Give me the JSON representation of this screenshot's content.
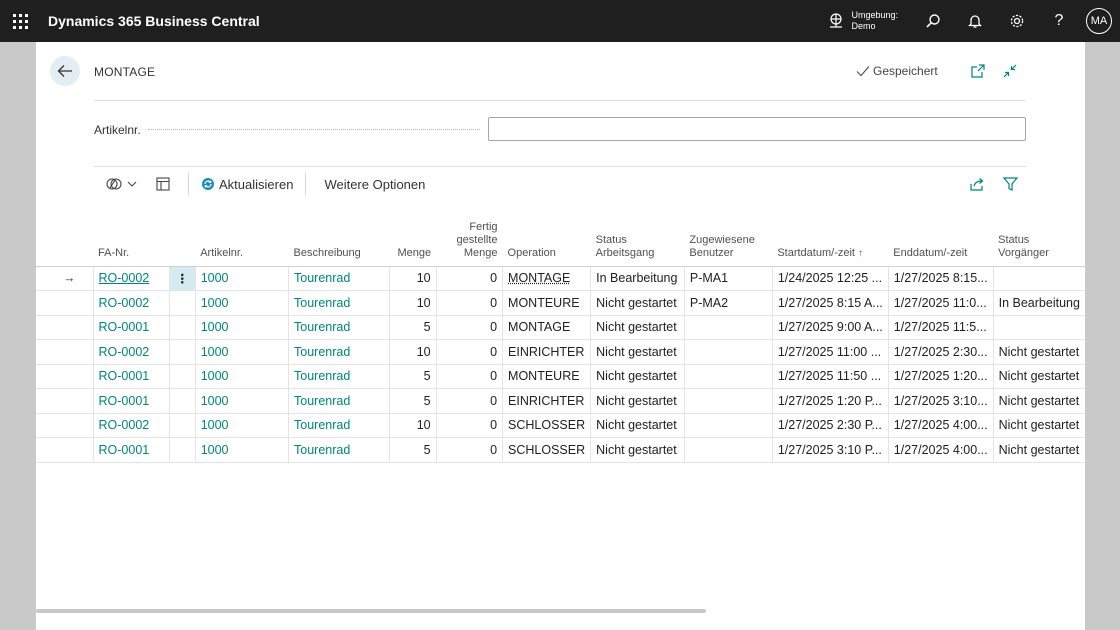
{
  "app": {
    "title": "Dynamics 365 Business Central",
    "environment_label": "Umgebung:",
    "environment_value": "Demo",
    "user_initials": "MA"
  },
  "page": {
    "title": "MONTAGE",
    "saved_status": "Gespeichert"
  },
  "filter": {
    "label": "Artikelnr.",
    "value": ""
  },
  "toolbar": {
    "refresh_label": "Aktualisieren",
    "more_options_label": "Weitere Optionen"
  },
  "table": {
    "headers": {
      "fa_nr": "FA-Nr.",
      "artikelnr": "Artikelnr.",
      "beschreibung": "Beschreibung",
      "menge": "Menge",
      "fertig_line1": "Fertig",
      "fertig_line2": "gestellte",
      "fertig_line3": "Menge",
      "operation": "Operation",
      "status_ag_line1": "Status",
      "status_ag_line2": "Arbeitsgang",
      "zugewiesen_line1": "Zugewiesene",
      "zugewiesen_line2": "Benutzer",
      "startdatum": "Startdatum/-zeit",
      "enddatum": "Enddatum/-zeit",
      "status_vorgaenger": "Status Vorgänger"
    },
    "rows": [
      {
        "fa_nr": "RO-0002",
        "artikelnr": "1000",
        "beschreibung": "Tourenrad",
        "menge": "10",
        "fertig": "0",
        "operation": "MONTAGE",
        "status": "In Bearbeitung",
        "benutzer": "P-MA1",
        "start": "1/24/2025 12:25 ...",
        "ende": "1/27/2025 8:15...",
        "vorgaenger": ""
      },
      {
        "fa_nr": "RO-0002",
        "artikelnr": "1000",
        "beschreibung": "Tourenrad",
        "menge": "10",
        "fertig": "0",
        "operation": "MONTEURE",
        "status": "Nicht gestartet",
        "benutzer": "P-MA2",
        "start": "1/27/2025 8:15 A...",
        "ende": "1/27/2025 11:0...",
        "vorgaenger": "In Bearbeitung"
      },
      {
        "fa_nr": "RO-0001",
        "artikelnr": "1000",
        "beschreibung": "Tourenrad",
        "menge": "5",
        "fertig": "0",
        "operation": "MONTAGE",
        "status": "Nicht gestartet",
        "benutzer": "",
        "start": "1/27/2025 9:00 A...",
        "ende": "1/27/2025 11:5...",
        "vorgaenger": ""
      },
      {
        "fa_nr": "RO-0002",
        "artikelnr": "1000",
        "beschreibung": "Tourenrad",
        "menge": "10",
        "fertig": "0",
        "operation": "EINRICHTER",
        "status": "Nicht gestartet",
        "benutzer": "",
        "start": "1/27/2025 11:00 ...",
        "ende": "1/27/2025 2:30...",
        "vorgaenger": "Nicht gestartet"
      },
      {
        "fa_nr": "RO-0001",
        "artikelnr": "1000",
        "beschreibung": "Tourenrad",
        "menge": "5",
        "fertig": "0",
        "operation": "MONTEURE",
        "status": "Nicht gestartet",
        "benutzer": "",
        "start": "1/27/2025 11:50 ...",
        "ende": "1/27/2025 1:20...",
        "vorgaenger": "Nicht gestartet"
      },
      {
        "fa_nr": "RO-0001",
        "artikelnr": "1000",
        "beschreibung": "Tourenrad",
        "menge": "5",
        "fertig": "0",
        "operation": "EINRICHTER",
        "status": "Nicht gestartet",
        "benutzer": "",
        "start": "1/27/2025 1:20 P...",
        "ende": "1/27/2025 3:10...",
        "vorgaenger": "Nicht gestartet"
      },
      {
        "fa_nr": "RO-0002",
        "artikelnr": "1000",
        "beschreibung": "Tourenrad",
        "menge": "10",
        "fertig": "0",
        "operation": "SCHLOSSER",
        "status": "Nicht gestartet",
        "benutzer": "",
        "start": "1/27/2025 2:30 P...",
        "ende": "1/27/2025 4:00...",
        "vorgaenger": "Nicht gestartet"
      },
      {
        "fa_nr": "RO-0001",
        "artikelnr": "1000",
        "beschreibung": "Tourenrad",
        "menge": "5",
        "fertig": "0",
        "operation": "SCHLOSSER",
        "status": "Nicht gestartet",
        "benutzer": "",
        "start": "1/27/2025 3:10 P...",
        "ende": "1/27/2025 4:00...",
        "vorgaenger": "Nicht gestartet"
      }
    ]
  },
  "colors": {
    "topbar": "#1f1f1f",
    "link": "#00857a",
    "selection": "#d5ebf0"
  }
}
